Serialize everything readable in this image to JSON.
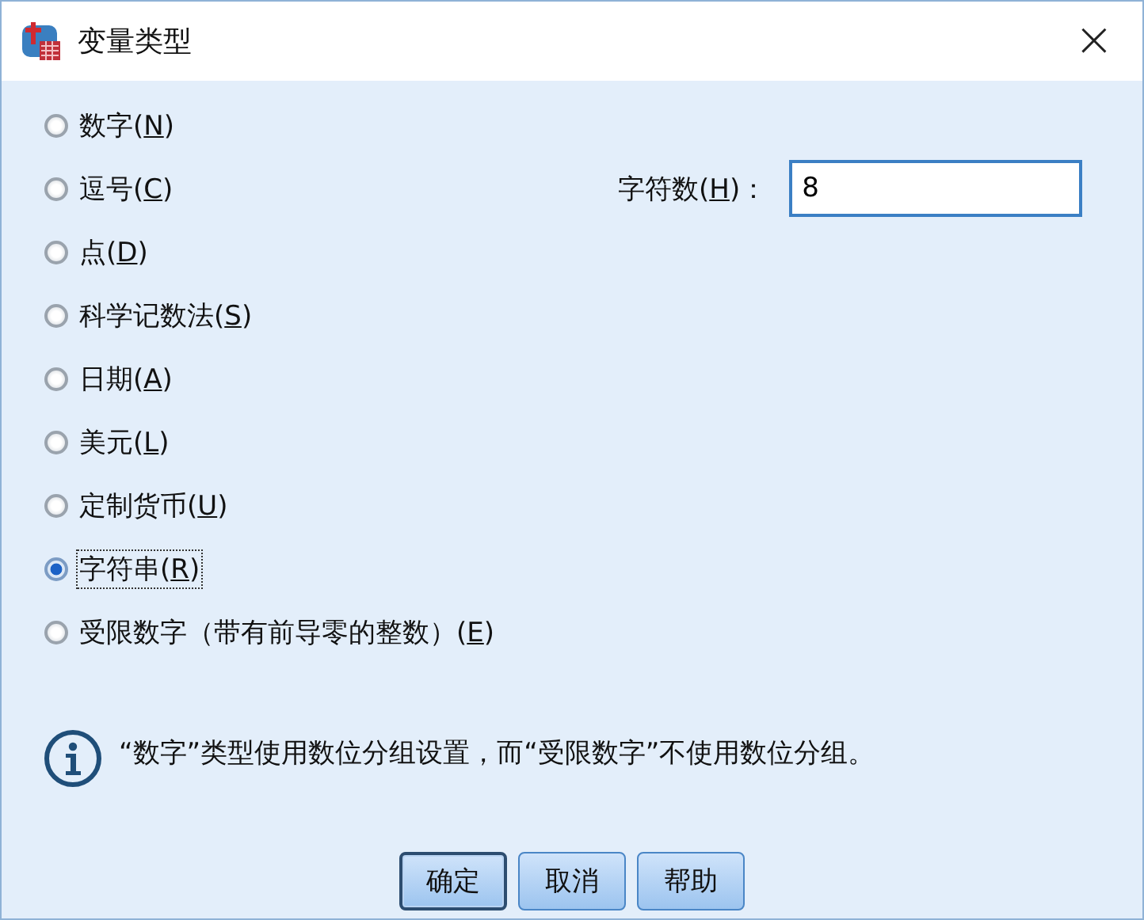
{
  "window": {
    "title": "变量类型",
    "close": "×"
  },
  "types": [
    {
      "before": "数字(",
      "mnemonic": "N",
      "after": ")",
      "selected": false
    },
    {
      "before": "逗号(",
      "mnemonic": "C",
      "after": ")",
      "selected": false
    },
    {
      "before": "点(",
      "mnemonic": "D",
      "after": ")",
      "selected": false
    },
    {
      "before": "科学记数法(",
      "mnemonic": "S",
      "after": ")",
      "selected": false
    },
    {
      "before": "日期(",
      "mnemonic": "A",
      "after": ")",
      "selected": false
    },
    {
      "before": "美元(",
      "mnemonic": "L",
      "after": ")",
      "selected": false
    },
    {
      "before": "定制货币(",
      "mnemonic": "U",
      "after": ")",
      "selected": false
    },
    {
      "before": "字符串(",
      "mnemonic": "R",
      "after": ")",
      "selected": true
    },
    {
      "before": "受限数字（带有前导零的整数）(",
      "mnemonic": "E",
      "after": ")",
      "selected": false
    }
  ],
  "width_field": {
    "before": "字符数(",
    "mnemonic": "H",
    "after": ")：",
    "value": "8"
  },
  "info": "“数字”类型使用数位分组设置，而“受限数字”不使用数位分组。",
  "buttons": [
    {
      "label": "确定",
      "default": true
    },
    {
      "label": "取消",
      "default": false
    },
    {
      "label": "帮助",
      "default": false
    }
  ]
}
